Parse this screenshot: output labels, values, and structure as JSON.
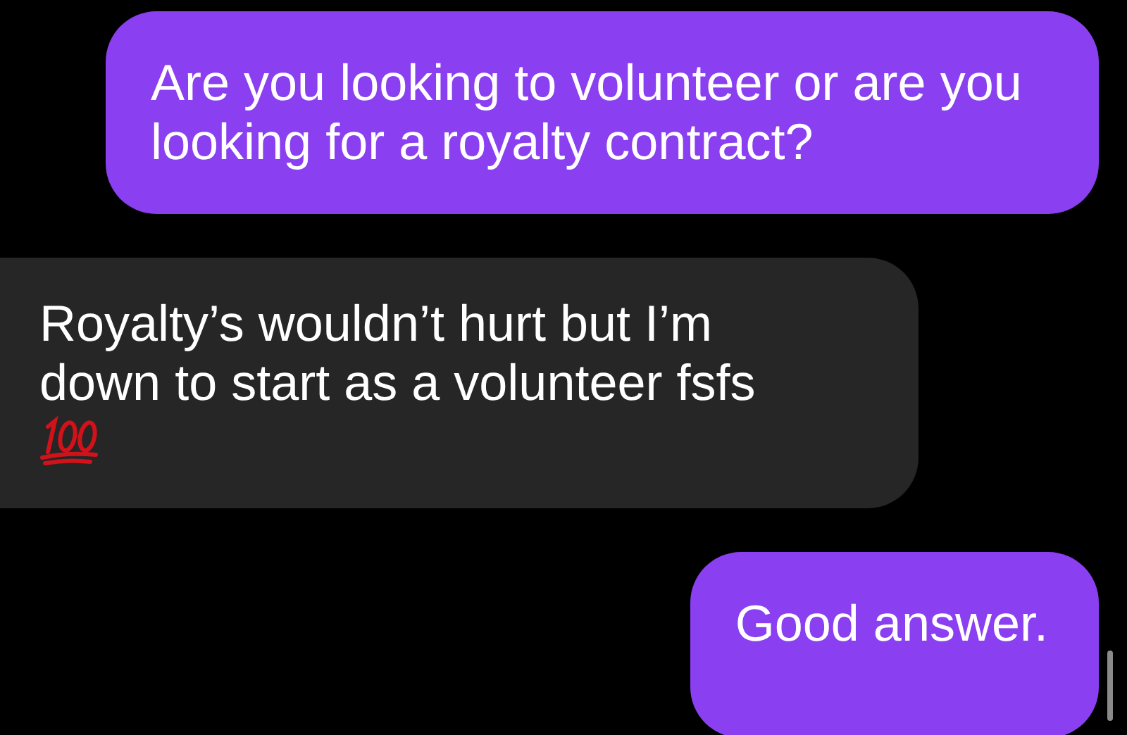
{
  "messages": [
    {
      "kind": "sent",
      "text": "Are you looking to volunteer or are you looking for a royalty contract?"
    },
    {
      "kind": "received",
      "text": "Royalty’s wouldn’t hurt but I’m down to start as a volunteer fsfs",
      "trailing_icon": true
    },
    {
      "kind": "sent",
      "text": "Good answer."
    }
  ]
}
